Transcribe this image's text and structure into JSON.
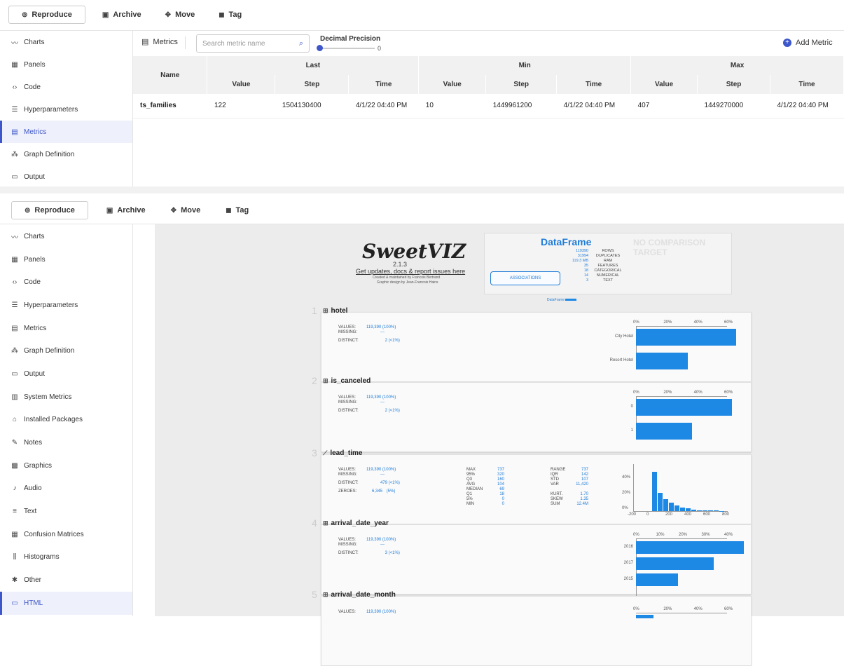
{
  "toolbar": {
    "reproduce": "Reproduce",
    "archive": "Archive",
    "move": "Move",
    "tag": "Tag"
  },
  "sidebar_top": [
    "Charts",
    "Panels",
    "Code",
    "Hyperparameters",
    "Metrics",
    "Graph Definition",
    "Output"
  ],
  "sidebar_bottom": [
    "Charts",
    "Panels",
    "Code",
    "Hyperparameters",
    "Metrics",
    "Graph Definition",
    "Output",
    "System Metrics",
    "Installed Packages",
    "Notes",
    "Graphics",
    "Audio",
    "Text",
    "Confusion Matrices",
    "Histograms",
    "Other",
    "HTML"
  ],
  "sidebar_icons_bottom": [
    "chart-line-icon",
    "panels-icon",
    "code-icon",
    "list-icon",
    "metrics-icon",
    "graph-icon",
    "output-icon",
    "system-icon",
    "package-icon",
    "notes-icon",
    "graphics-icon",
    "audio-icon",
    "text-icon",
    "matrix-icon",
    "histogram-icon",
    "other-icon",
    "html-icon"
  ],
  "metrics_header": {
    "tab_label": "Metrics",
    "search_placeholder": "Search metric name",
    "precision_label": "Decimal Precision",
    "precision_value": "0",
    "add_metric": "Add Metric"
  },
  "metrics_table": {
    "name_header": "Name",
    "groups": [
      "Last",
      "Min",
      "Max"
    ],
    "subheaders": [
      "Value",
      "Step",
      "Time"
    ],
    "rows": [
      {
        "name": "ts_families",
        "last_value": "122",
        "last_step": "1504130400",
        "last_time": "4/1/22 04:40 PM",
        "min_value": "10",
        "min_step": "1449961200",
        "min_time": "4/1/22 04:40 PM",
        "max_value": "407",
        "max_step": "1449270000",
        "max_time": "4/1/22 04:40 PM"
      }
    ]
  },
  "report": {
    "logo": "SweetVIZ",
    "version": "2.1.3",
    "updates_link": "Get updates, docs & report issues here",
    "created_by": "Created & maintained by Francois Bertrand",
    "graphic_design": "Graphic design by Jean-Francois Hains",
    "df_title": "DataFrame",
    "no_comparison": "NO COMPARISON TARGET",
    "associations": "ASSOCIATIONS",
    "df_legend": "DataFrame",
    "df_stats": [
      {
        "value": "119390",
        "label": "ROWS"
      },
      {
        "value": "31994",
        "label": "DUPLICATES"
      },
      {
        "value": "119.3 MB",
        "label": "RAM"
      },
      {
        "value": "35",
        "label": "FEATURES"
      },
      {
        "value": "18",
        "label": "CATEGORICAL"
      },
      {
        "value": "14",
        "label": "NUMERICAL"
      },
      {
        "value": "3",
        "label": "TEXT"
      }
    ],
    "features": [
      {
        "num": "1",
        "name": "hotel",
        "values": "119,390 (100%)",
        "missing": "---",
        "distinct": "2",
        "distinct_pct": "(<1%)",
        "ticks": [
          "0%",
          "20%",
          "40%",
          "60%"
        ],
        "cats": [
          {
            "label": "City Hotel",
            "pct": 66
          },
          {
            "label": "Resort Hotel",
            "pct": 34
          }
        ]
      },
      {
        "num": "2",
        "name": "is_canceled",
        "values": "119,390 (100%)",
        "missing": "---",
        "distinct": "2",
        "distinct_pct": "(<1%)",
        "ticks": [
          "0%",
          "20%",
          "40%",
          "60%"
        ],
        "cats": [
          {
            "label": "0",
            "pct": 63
          },
          {
            "label": "1",
            "pct": 37
          }
        ]
      },
      {
        "num": "3",
        "name": "lead_time",
        "values": "119,390 (100%)",
        "missing": "---",
        "distinct": "479",
        "distinct_pct": "(<1%)",
        "zeroes": "6,345",
        "zeroes_pct": "(5%)",
        "quant": [
          [
            "MAX",
            "737"
          ],
          [
            "95%",
            "320"
          ],
          [
            "Q3",
            "160"
          ],
          [
            "AVG",
            "104"
          ],
          [
            "MEDIAN",
            "69"
          ],
          [
            "Q1",
            "18"
          ],
          [
            "5%",
            "0"
          ],
          [
            "MIN",
            "0"
          ]
        ],
        "moments": [
          [
            "RANGE",
            "737"
          ],
          [
            "IQR",
            "142"
          ],
          [
            "STD",
            "107"
          ],
          [
            "VAR",
            "11,420"
          ],
          [
            "",
            ""
          ],
          [
            "KURT.",
            "1.70"
          ],
          [
            "SKEW",
            "1.35"
          ],
          [
            "SUM",
            "12.4M"
          ]
        ],
        "hist_y": [
          "40%",
          "20%",
          "0%"
        ],
        "hist_x": [
          "-200",
          "0",
          "200",
          "400",
          "600",
          "800"
        ],
        "hist": [
          47,
          22,
          14,
          10,
          7,
          4,
          3,
          2,
          1,
          1,
          0.5,
          0.5,
          0.3
        ]
      },
      {
        "num": "4",
        "name": "arrival_date_year",
        "values": "119,390 (100%)",
        "missing": "---",
        "distinct": "3",
        "distinct_pct": "(<1%)",
        "ticks": [
          "0%",
          "10%",
          "20%",
          "30%",
          "40%"
        ],
        "cats": [
          {
            "label": "2016",
            "pct": 47.5
          },
          {
            "label": "2017",
            "pct": 34
          },
          {
            "label": "2015",
            "pct": 18.5
          }
        ]
      },
      {
        "num": "5",
        "name": "arrival_date_month",
        "values": "119,390 (100%)",
        "missing": "---",
        "ticks": [
          "0%",
          "20%",
          "40%",
          "60%"
        ]
      }
    ]
  }
}
